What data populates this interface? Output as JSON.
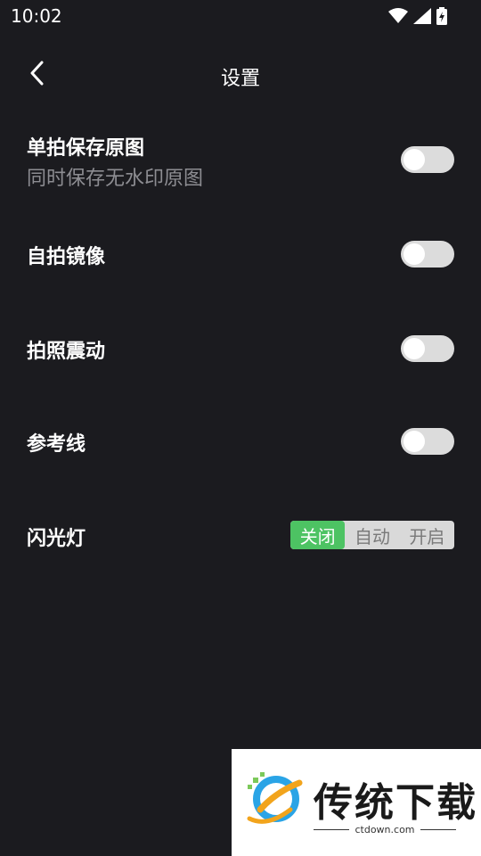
{
  "status_bar": {
    "time": "10:02",
    "icons": [
      "wifi-icon",
      "signal-icon",
      "battery-charging-icon"
    ]
  },
  "header": {
    "title": "设置",
    "back_icon": "chevron-left-icon"
  },
  "settings": [
    {
      "title": "单拍保存原图",
      "subtitle": "同时保存无水印原图",
      "enabled": false
    },
    {
      "title": "自拍镜像",
      "enabled": false
    },
    {
      "title": "拍照震动",
      "enabled": false
    },
    {
      "title": "参考线",
      "enabled": false
    }
  ],
  "flash": {
    "title": "闪光灯",
    "options": [
      "关闭",
      "自动",
      "开启"
    ],
    "selected": "关闭"
  },
  "watermark": {
    "brand": "传统下载",
    "url": "ctdown.com"
  },
  "colors": {
    "background": "#1b1b1f",
    "accent": "#4dc363",
    "toggle_off": "#dcdcdc",
    "subtitle": "#8d8d92"
  }
}
